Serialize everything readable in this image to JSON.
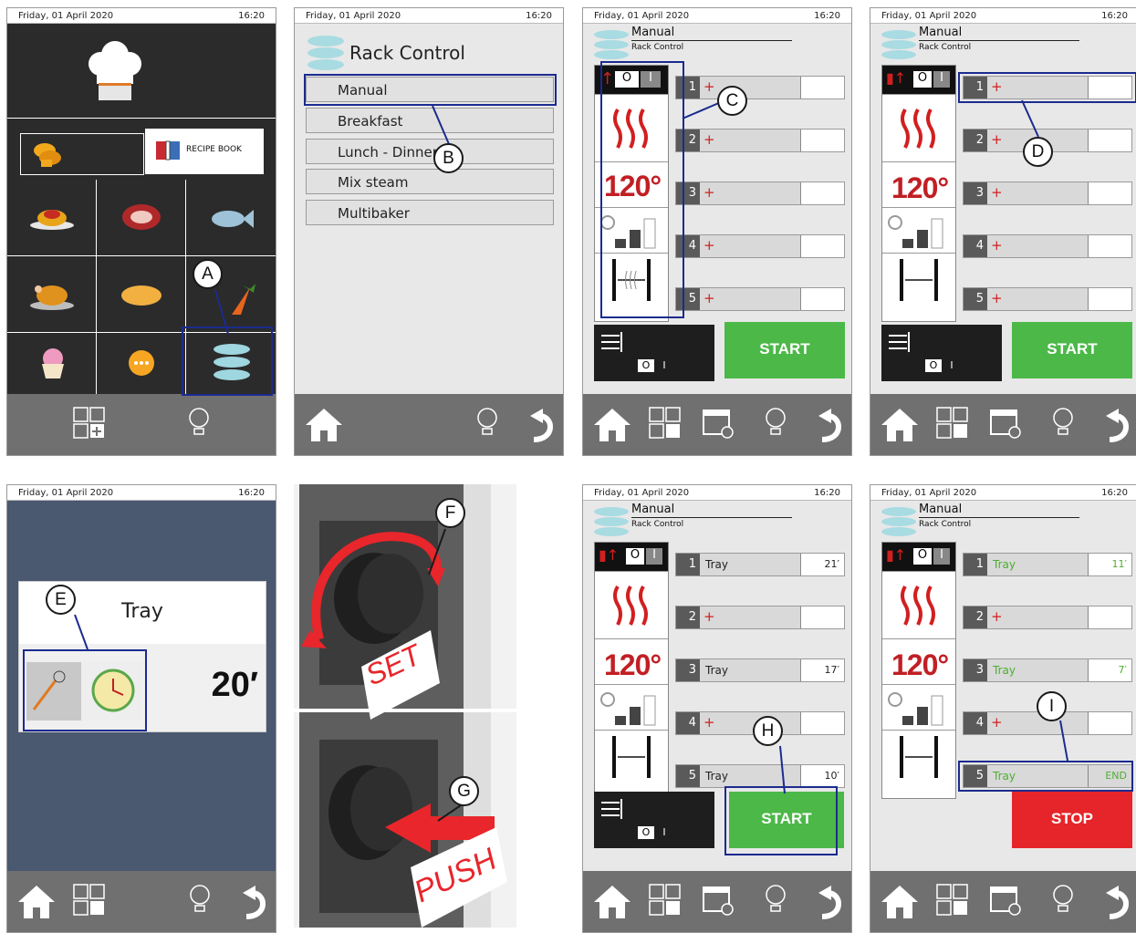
{
  "status": {
    "date": "Friday, 01 April 2020",
    "time": "16:20"
  },
  "p1": {
    "recipe_book": "RECIPE BOOK"
  },
  "p2": {
    "title": "Rack Control",
    "items": [
      "Manual",
      "Breakfast",
      "Lunch - Dinner",
      "Mix steam",
      "Multibaker"
    ]
  },
  "header": {
    "title": "Manual",
    "subtitle": "Rack Control"
  },
  "temperature": "120°",
  "toggle": {
    "off": "O",
    "on": "I"
  },
  "trays_empty": [
    {
      "n": "1"
    },
    {
      "n": "2"
    },
    {
      "n": "3"
    },
    {
      "n": "4"
    },
    {
      "n": "5"
    }
  ],
  "plus": "+",
  "trays_set": [
    {
      "n": "1",
      "label": "Tray",
      "time": "21′"
    },
    {
      "n": "2",
      "label": "",
      "time": ""
    },
    {
      "n": "3",
      "label": "Tray",
      "time": "17′"
    },
    {
      "n": "4",
      "label": "",
      "time": ""
    },
    {
      "n": "5",
      "label": "Tray",
      "time": "10′"
    }
  ],
  "trays_run": [
    {
      "n": "1",
      "label": "Tray",
      "time": "11′"
    },
    {
      "n": "2",
      "label": "",
      "time": ""
    },
    {
      "n": "3",
      "label": "Tray",
      "time": "7′"
    },
    {
      "n": "4",
      "label": "",
      "time": ""
    },
    {
      "n": "5",
      "label": "Tray",
      "time": "END"
    }
  ],
  "start_label": "START",
  "stop_label": "STOP",
  "p5": {
    "title": "Tray",
    "time": "20′"
  },
  "knob": {
    "set": "SET",
    "push": "PUSH"
  },
  "callouts": {
    "a": "A",
    "b": "B",
    "c": "C",
    "d": "D",
    "e": "E",
    "f": "F",
    "g": "G",
    "h": "H",
    "i": "I"
  },
  "colors": {
    "highlight": "#1b2b8f",
    "start": "#4cb848",
    "stop": "#e5252a",
    "heat": "#c11f24"
  }
}
